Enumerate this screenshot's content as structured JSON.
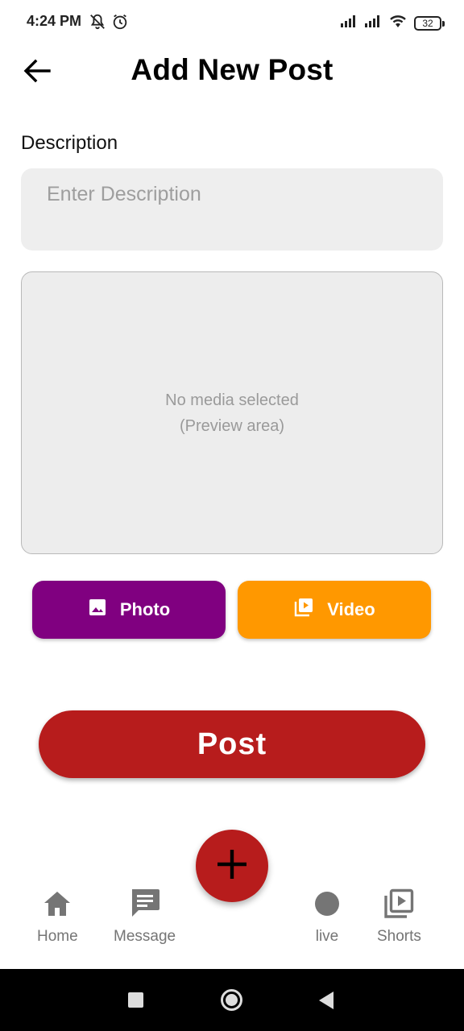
{
  "status_bar": {
    "time": "4:24 PM",
    "battery": "32",
    "icons": [
      "mute-bell-icon",
      "alarm-icon",
      "signal-icon",
      "signal-icon",
      "wifi-icon",
      "battery-icon"
    ]
  },
  "header": {
    "title": "Add New Post",
    "back_icon": "arrow-back-icon"
  },
  "form": {
    "description_label": "Description",
    "description_placeholder": "Enter Description",
    "description_value": ""
  },
  "preview": {
    "line1": "No media selected",
    "line2": "(Preview area)"
  },
  "media_buttons": {
    "photo_label": "Photo",
    "video_label": "Video",
    "photo_color": "#800080",
    "video_color": "#ff9800"
  },
  "post_button": {
    "label": "Post",
    "color": "#b71c1c"
  },
  "bottom_nav": {
    "items": [
      {
        "label": "Home",
        "icon": "home-icon"
      },
      {
        "label": "Message",
        "icon": "message-icon"
      },
      {
        "label": "live",
        "icon": "live-icon"
      },
      {
        "label": "Shorts",
        "icon": "shorts-icon"
      }
    ],
    "fab_icon": "plus-icon"
  },
  "system_nav": {
    "icons": [
      "recents-icon",
      "home-circle-icon",
      "back-triangle-icon"
    ]
  }
}
